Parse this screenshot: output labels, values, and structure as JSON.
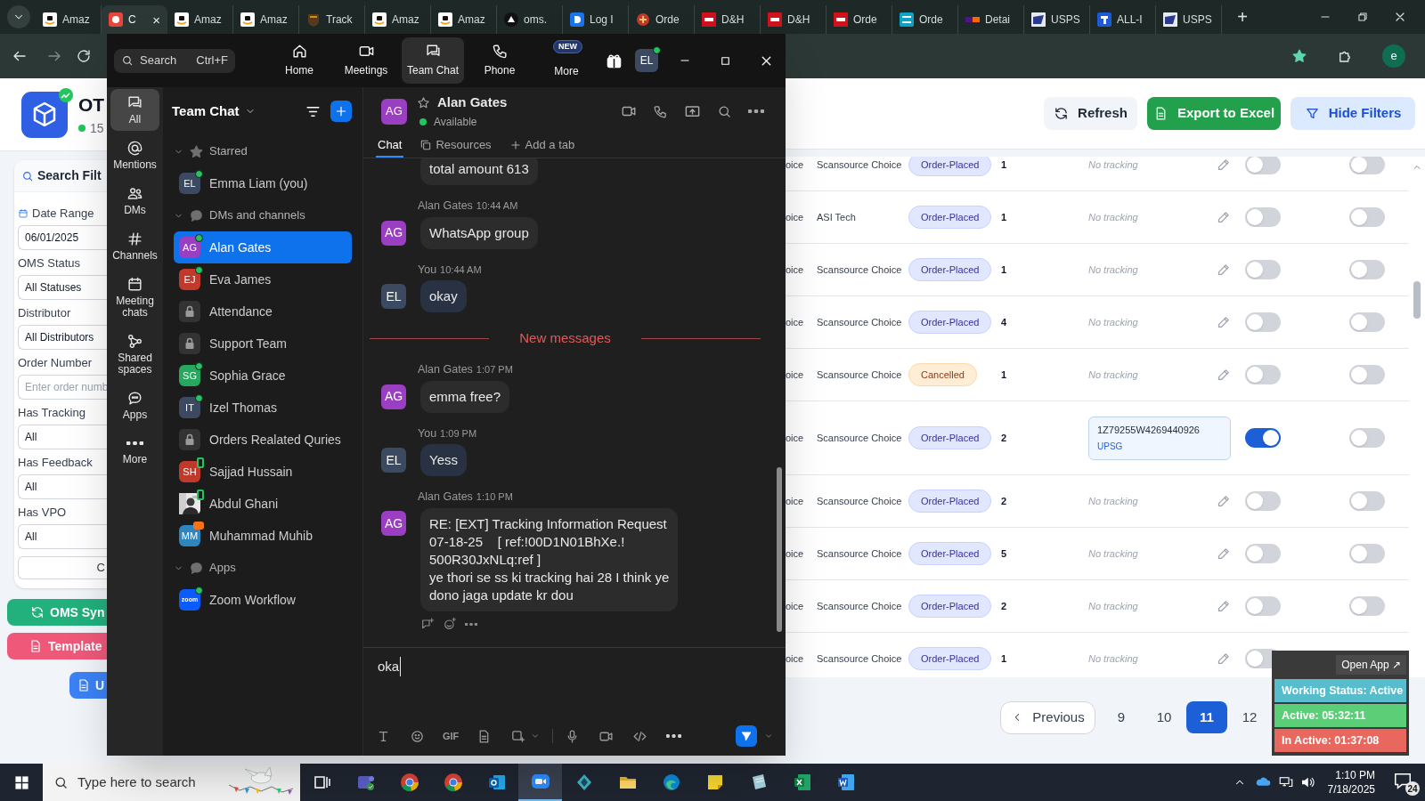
{
  "browser": {
    "tabs": [
      {
        "title": "Amaz",
        "selected": false
      },
      {
        "title": "C",
        "selected": true,
        "close": "×"
      },
      {
        "title": "Amaz",
        "selected": false
      },
      {
        "title": "Amaz",
        "selected": false
      },
      {
        "title": "Track",
        "selected": false
      },
      {
        "title": "Amaz",
        "selected": false
      },
      {
        "title": "Amaz",
        "selected": false
      },
      {
        "title": "oms.",
        "selected": false
      },
      {
        "title": "Log I",
        "selected": false
      },
      {
        "title": "Orde",
        "selected": false
      },
      {
        "title": "D&H",
        "selected": false
      },
      {
        "title": "D&H",
        "selected": false
      },
      {
        "title": "Orde",
        "selected": false
      },
      {
        "title": "Orde",
        "selected": false
      },
      {
        "title": "Detai",
        "selected": false
      },
      {
        "title": "USPS",
        "selected": false
      },
      {
        "title": "ALL-I",
        "selected": false
      },
      {
        "title": "USPS",
        "selected": false
      }
    ],
    "new_tab": "+",
    "profile": "e"
  },
  "page": {
    "title": "OT",
    "subtitle": "15",
    "filters": {
      "title": "Search Filt",
      "fields": [
        {
          "label": "Date Range",
          "kind": "date",
          "value": "06/01/2025"
        },
        {
          "label": "OMS Status",
          "kind": "select",
          "value": "All Statuses"
        },
        {
          "label": "Distributor",
          "kind": "select",
          "value": "All Distributors"
        },
        {
          "label": "Order Number",
          "kind": "text",
          "placeholder": "Enter order numb"
        },
        {
          "label": "Has Tracking",
          "kind": "select",
          "value": "All"
        },
        {
          "label": "Has Feedback",
          "kind": "select",
          "value": "All"
        },
        {
          "label": "Has VPO",
          "kind": "select",
          "value": "All"
        }
      ],
      "clear_button": "C"
    },
    "side_buttons": [
      {
        "label": "OMS Syn",
        "kind": "sync"
      },
      {
        "label": "Template",
        "kind": "template"
      },
      {
        "label": "U",
        "kind": "upload"
      }
    ],
    "actions": [
      {
        "label": "Refresh",
        "kind": "refresh"
      },
      {
        "label": "Export to Excel",
        "kind": "export"
      },
      {
        "label": "Hide Filters",
        "kind": "filter"
      }
    ],
    "rows": [
      {
        "cell_1": "oice",
        "distributor": "Scansource Choice",
        "status": {
          "label": "Order-Placed",
          "kind": "placed"
        },
        "quantity": "1",
        "tracking": {
          "kind": "none",
          "text": "No tracking"
        },
        "toggle_1": false,
        "toggle_2": false
      },
      {
        "cell_1": "oice",
        "distributor": "ASI Tech",
        "status": {
          "label": "Order-Placed",
          "kind": "placed"
        },
        "quantity": "1",
        "tracking": {
          "kind": "none",
          "text": "No tracking"
        },
        "toggle_1": false,
        "toggle_2": false
      },
      {
        "cell_1": "oice",
        "distributor": "Scansource Choice",
        "status": {
          "label": "Order-Placed",
          "kind": "placed"
        },
        "quantity": "1",
        "tracking": {
          "kind": "none",
          "text": "No tracking"
        },
        "toggle_1": false,
        "toggle_2": false
      },
      {
        "cell_1": "oice",
        "distributor": "Scansource Choice",
        "status": {
          "label": "Order-Placed",
          "kind": "placed"
        },
        "quantity": "4",
        "tracking": {
          "kind": "none",
          "text": "No tracking"
        },
        "toggle_1": false,
        "toggle_2": false
      },
      {
        "cell_1": "oice",
        "distributor": "Scansource Choice",
        "status": {
          "label": "Cancelled",
          "kind": "cancelled"
        },
        "quantity": "1",
        "tracking": {
          "kind": "none",
          "text": "No tracking"
        },
        "toggle_1": false,
        "toggle_2": false
      },
      {
        "cell_1": "oice",
        "distributor": "Scansource Choice",
        "status": {
          "label": "Order-Placed",
          "kind": "placed"
        },
        "quantity": "2",
        "tracking": {
          "kind": "number",
          "number": "1Z79255W4269440926",
          "carrier": "UPSG"
        },
        "toggle_1": true,
        "toggle_2": false
      },
      {
        "cell_1": "oice",
        "distributor": "Scansource Choice",
        "status": {
          "label": "Order-Placed",
          "kind": "placed"
        },
        "quantity": "2",
        "tracking": {
          "kind": "none",
          "text": "No tracking"
        },
        "toggle_1": false,
        "toggle_2": false
      },
      {
        "cell_1": "oice",
        "distributor": "Scansource Choice",
        "status": {
          "label": "Order-Placed",
          "kind": "placed"
        },
        "quantity": "5",
        "tracking": {
          "kind": "none",
          "text": "No tracking"
        },
        "toggle_1": false,
        "toggle_2": false
      },
      {
        "cell_1": "oice",
        "distributor": "Scansource Choice",
        "status": {
          "label": "Order-Placed",
          "kind": "placed"
        },
        "quantity": "2",
        "tracking": {
          "kind": "none",
          "text": "No tracking"
        },
        "toggle_1": false,
        "toggle_2": false
      },
      {
        "cell_1": "oice",
        "distributor": "Scansource Choice",
        "status": {
          "label": "Order-Placed",
          "kind": "placed"
        },
        "quantity": "1",
        "tracking": {
          "kind": "none",
          "text": "No tracking"
        },
        "toggle_1": false
      }
    ],
    "pagination": {
      "previous": "Previous",
      "pages": [
        {
          "label": "9",
          "selected": false
        },
        {
          "label": "10",
          "selected": false
        },
        {
          "label": "11",
          "selected": true
        },
        {
          "label": "12",
          "selected": false
        }
      ]
    }
  },
  "status_widget": {
    "open_app": "Open App ↗",
    "lines": [
      {
        "text": "Working Status: Active",
        "color": "#57bccb"
      },
      {
        "text": "Active: 05:32:11",
        "color": "#5cce78"
      },
      {
        "text": "In Active: 01:37:08",
        "color": "#e8675f"
      }
    ]
  },
  "zoom": {
    "search": {
      "placeholder": "Search",
      "shortcut": "Ctrl+F"
    },
    "nav": [
      {
        "label": "Home",
        "selected": false
      },
      {
        "label": "Meetings",
        "selected": false
      },
      {
        "label": "Team Chat",
        "selected": true
      },
      {
        "label": "Phone",
        "selected": false
      },
      {
        "label": "More",
        "selected": false,
        "badge": "NEW"
      }
    ],
    "avatar": {
      "initials": "EL",
      "online": true
    },
    "rail": [
      {
        "label": "All",
        "selected": true
      },
      {
        "label": "Mentions",
        "selected": false
      },
      {
        "label": "DMs",
        "selected": false
      },
      {
        "label": "Channels",
        "selected": false
      },
      {
        "label": "Meeting chats",
        "selected": false
      },
      {
        "label": "Shared spaces",
        "selected": false
      },
      {
        "label": "Apps",
        "selected": false
      },
      {
        "label": "More",
        "selected": false
      }
    ],
    "list": {
      "title": "Team Chat",
      "sections": [
        {
          "title": "Starred",
          "expanded": true,
          "items": [
            {
              "name": "Emma Liam (you)",
              "kind": "person",
              "initials": "EL",
              "color": "#3c4a61",
              "presence": {
                "kind": "online"
              },
              "selected": false
            }
          ]
        },
        {
          "title": "DMs and channels",
          "expanded": true,
          "items": [
            {
              "name": "Alan Gates",
              "kind": "person",
              "initials": "AG",
              "color": "#9a3fc2",
              "presence": {
                "kind": "online"
              },
              "selected": true
            },
            {
              "name": "Eva James",
              "kind": "person",
              "initials": "EJ",
              "color": "#c0392b",
              "presence": {
                "kind": "online"
              },
              "selected": false
            },
            {
              "name": "Attendance",
              "kind": "channel",
              "selected": false
            },
            {
              "name": "Support Team",
              "kind": "channel",
              "selected": false
            },
            {
              "name": "Sophia Grace",
              "kind": "person",
              "initials": "SG",
              "color": "#27a85f",
              "presence": {
                "kind": "online"
              },
              "selected": false
            },
            {
              "name": "Izel Thomas",
              "kind": "person",
              "initials": "IT",
              "color": "#3c4a61",
              "presence": {
                "kind": "online"
              },
              "selected": false
            },
            {
              "name": "Orders Realated Quries",
              "kind": "channel",
              "selected": false
            },
            {
              "name": "Sajjad Hussain",
              "kind": "person",
              "initials": "SH",
              "color": "#c0392b",
              "presence": {
                "kind": "mobile"
              },
              "selected": false
            },
            {
              "name": "Abdul Ghani",
              "presence": {
                "kind": "mobile"
              },
              "selected": false
            },
            {
              "name": "Muhammad Muhib",
              "kind": "person",
              "initials": "MM",
              "color": "#2e86c1",
              "presence": {
                "kind": "meeting"
              },
              "selected": false
            }
          ]
        },
        {
          "title": "Apps",
          "expanded": true,
          "items": [
            {
              "name": "Zoom Workflow",
              "kind": "app",
              "initials": "zoom",
              "color": "#0b5cff",
              "presence": {
                "kind": "online"
              },
              "selected": false
            }
          ]
        }
      ]
    },
    "chat": {
      "contact": {
        "initials": "AG",
        "color": "#9a3fc2",
        "name": "Alan Gates",
        "status": "Available",
        "online": true,
        "starred": false
      },
      "tabs": [
        {
          "label": "Chat",
          "selected": true
        },
        {
          "label": "Resources",
          "selected": false
        },
        {
          "label": "Add a tab",
          "selected": false
        }
      ],
      "messages": [
        {
          "kind": "message",
          "mine": false,
          "text": "total amount 613"
        },
        {
          "kind": "message",
          "author": "Alan Gates",
          "time": "10:44 AM",
          "initials": "AG",
          "mine": false,
          "text": "WhatsApp group"
        },
        {
          "kind": "message",
          "author": "You",
          "time": "10:44 AM",
          "initials": "EL",
          "mine": true,
          "text": "okay"
        },
        {
          "kind": "divider",
          "text": "New messages"
        },
        {
          "kind": "message",
          "author": "Alan Gates",
          "time": "1:07 PM",
          "initials": "AG",
          "mine": false,
          "text": "emma free?"
        },
        {
          "kind": "message",
          "author": "You",
          "time": "1:09 PM",
          "initials": "EL",
          "mine": true,
          "text": "Yess"
        },
        {
          "kind": "message",
          "author": "Alan Gates",
          "time": "1:10 PM",
          "initials": "AG",
          "mine": false,
          "text": "RE: [EXT] Tracking Information Request\n07-18-25    [ ref:!00D1N01BhXe.!\n500R30JxNLq:ref ]\nye thori se ss ki tracking hai 28 I think ye\ndono jaga update kr dou",
          "reactions": true
        }
      ],
      "composer": {
        "value": "oka",
        "gif": "GIF"
      }
    }
  },
  "taskbar": {
    "search_placeholder": "Type here to search",
    "apps": [
      {
        "kind": "taskview",
        "selected": false
      },
      {
        "kind": "teams",
        "selected": false
      },
      {
        "kind": "chrome",
        "selected": false
      },
      {
        "kind": "chrome",
        "selected": false
      },
      {
        "kind": "outlook",
        "selected": false
      },
      {
        "kind": "zoom",
        "selected": true
      },
      {
        "kind": "diamond",
        "selected": false
      },
      {
        "kind": "folder",
        "selected": false
      },
      {
        "kind": "edge",
        "selected": false
      },
      {
        "kind": "notes",
        "selected": false
      },
      {
        "kind": "paper",
        "selected": false
      },
      {
        "kind": "excel",
        "selected": false
      },
      {
        "kind": "word",
        "selected": false
      }
    ],
    "time": "1:10 PM",
    "date": "7/18/2025",
    "notifications": "24"
  }
}
